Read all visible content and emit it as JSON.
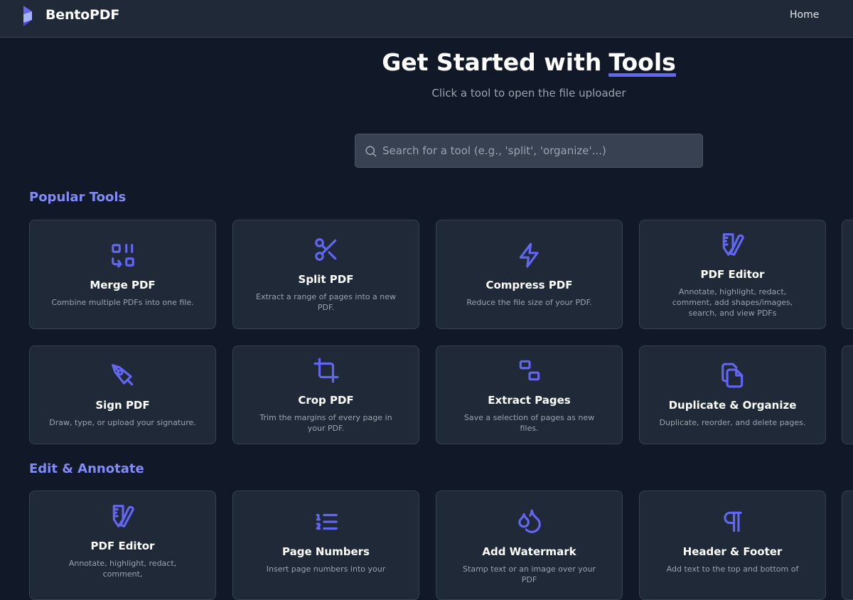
{
  "header": {
    "brand": "BentoPDF",
    "nav_home": "Home"
  },
  "hero": {
    "title_prefix": "Get Started with",
    "title_highlight": "Tools",
    "subtitle": "Click a tool to open the file uploader"
  },
  "search": {
    "placeholder": "Search for a tool (e.g., 'split', 'organize'...)",
    "value": ""
  },
  "colors": {
    "accent": "#6366f1",
    "section_heading": "#818cf8",
    "background": "#111827",
    "card": "#1f2937"
  },
  "sections": [
    {
      "title": "Popular Tools",
      "tools": [
        {
          "icon": "merge-icon",
          "title": "Merge PDF",
          "desc": "Combine multiple PDFs into one file."
        },
        {
          "icon": "scissors-icon",
          "title": "Split PDF",
          "desc": "Extract a range of pages into a new PDF."
        },
        {
          "icon": "lightning-icon",
          "title": "Compress PDF",
          "desc": "Reduce the file size of your PDF."
        },
        {
          "icon": "pencil-ruler-icon",
          "title": "PDF Editor",
          "desc": "Annotate, highlight, redact, comment, add shapes/images, search, and view PDFs"
        },
        {
          "icon": "pen-nib-icon",
          "title": "Sign PDF",
          "desc": "Draw, type, or upload your signature."
        },
        {
          "icon": "crop-icon",
          "title": "Crop PDF",
          "desc": "Trim the margins of every page in your PDF."
        },
        {
          "icon": "extract-pages-icon",
          "title": "Extract Pages",
          "desc": "Save a selection of pages as new files."
        },
        {
          "icon": "copy-icon",
          "title": "Duplicate & Organize",
          "desc": "Duplicate, reorder, and delete pages."
        }
      ]
    },
    {
      "title": "Edit & Annotate",
      "tools": [
        {
          "icon": "pencil-ruler-icon",
          "title": "PDF Editor",
          "desc": "Annotate, highlight, redact, comment,"
        },
        {
          "icon": "list-ordered-icon",
          "title": "Page Numbers",
          "desc": "Insert page numbers into your"
        },
        {
          "icon": "droplets-icon",
          "title": "Add Watermark",
          "desc": "Stamp text or an image over your PDF"
        },
        {
          "icon": "pilcrow-icon",
          "title": "Header & Footer",
          "desc": "Add text to the top and bottom of"
        }
      ]
    }
  ]
}
